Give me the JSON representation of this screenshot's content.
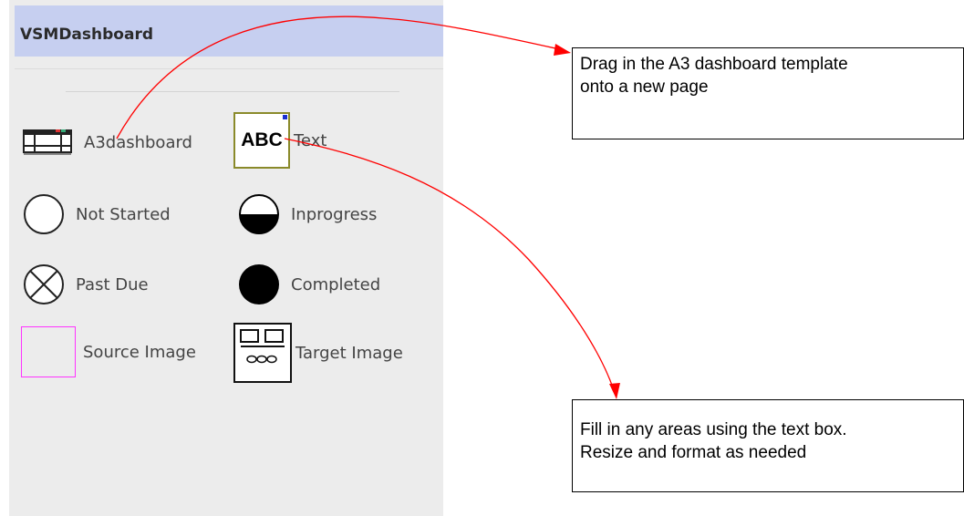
{
  "panel": {
    "title": "VSMDashboard",
    "items": [
      {
        "label": "A3dashboard",
        "icon": "a3dashboard-icon"
      },
      {
        "label": "Text",
        "icon": "text-abc-icon"
      },
      {
        "label": "Not Started",
        "icon": "empty-circle-icon"
      },
      {
        "label": "Inprogress",
        "icon": "half-filled-circle-icon"
      },
      {
        "label": "Past Due",
        "icon": "circle-x-icon"
      },
      {
        "label": "Completed",
        "icon": "filled-circle-icon"
      },
      {
        "label": "Source Image",
        "icon": "magenta-square-icon"
      },
      {
        "label": "Target Image",
        "icon": "target-image-icon"
      }
    ],
    "text_icon_glyph": "ABC"
  },
  "callouts": {
    "top": [
      "Drag in the A3 dashboard template",
      "onto a new page"
    ],
    "bottom": [
      "Fill in any areas using the text box.",
      "Resize and format as needed"
    ]
  },
  "colors": {
    "header_bg": "#c6cff0",
    "panel_bg": "#ececec",
    "arrow": "#ff0000",
    "source_image_border": "#ff33ff",
    "text_icon_border": "#8a8a2a"
  }
}
